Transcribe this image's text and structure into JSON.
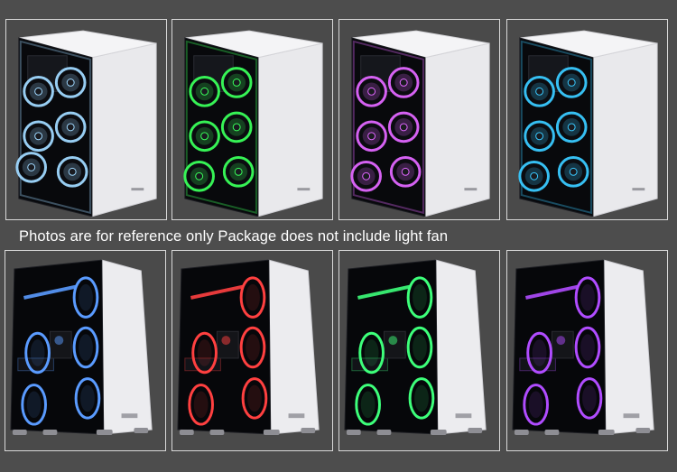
{
  "caption": "Photos are for reference only Package does not include light fan",
  "top_row": [
    {
      "label": "case-photo-blue-white-fans",
      "color": "#9fd8ff"
    },
    {
      "label": "case-photo-green-fans",
      "color": "#39ff5a"
    },
    {
      "label": "case-photo-purple-fans",
      "color": "#e066ff"
    },
    {
      "label": "case-photo-cyan-fans",
      "color": "#39c9ff"
    }
  ],
  "bottom_row": [
    {
      "label": "case-photo-blue-rings",
      "color": "#5a9bff"
    },
    {
      "label": "case-photo-red-rings",
      "color": "#ff4040"
    },
    {
      "label": "case-photo-green-rings",
      "color": "#3dff7a"
    },
    {
      "label": "case-photo-violet-rings",
      "color": "#b04cff"
    }
  ]
}
